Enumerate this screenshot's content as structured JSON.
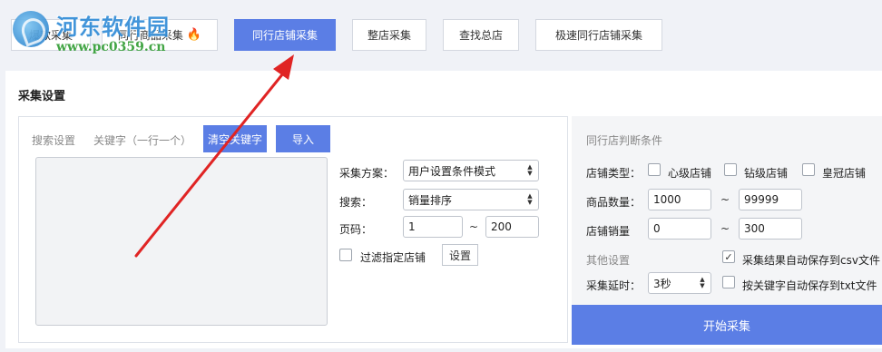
{
  "watermark": {
    "title": "河东软件园",
    "url": "www.pc0359.cn"
  },
  "tabs": [
    {
      "label": "爆款采集"
    },
    {
      "label": "同行商品采集"
    },
    {
      "label": "同行店铺采集"
    },
    {
      "label": "整店采集"
    },
    {
      "label": "查找总店"
    },
    {
      "label": "极速同行店铺采集"
    }
  ],
  "section_title": "采集设置",
  "left": {
    "sub_tab_search": "搜索设置",
    "sub_tab_keywords": "关键字（一行一个）",
    "clear_btn": "清空关键字",
    "import_btn": "导入",
    "keywords_value": "",
    "plan_label": "采集方案：",
    "plan_value": "用户设置条件模式",
    "search_label": "搜索：",
    "search_value": "销量排序",
    "page_label": "页码：",
    "page_from": "1",
    "page_to": "200",
    "tilde": "~",
    "filter_label": "过滤指定店铺",
    "filter_checked": false,
    "settings_btn": "设置"
  },
  "right": {
    "title": "同行店判断条件",
    "shop_type_label": "店铺类型：",
    "shop_types": [
      {
        "label": "心级店铺",
        "checked": false
      },
      {
        "label": "钻级店铺",
        "checked": false
      },
      {
        "label": "皇冠店铺",
        "checked": false
      }
    ],
    "product_count_label": "商品数量：",
    "product_count_from": "1000",
    "product_count_to": "99999",
    "shop_sales_label": "店铺销量",
    "shop_sales_from": "0",
    "shop_sales_to": "300",
    "tilde": "~",
    "other_label": "其他设置",
    "auto_save_csv_label": "采集结果自动保存到csv文件",
    "auto_save_csv_checked": true,
    "delay_label": "采集延时：",
    "delay_value": "3秒",
    "save_kw_txt_label": "按关键字自动保存到txt文件",
    "save_kw_txt_checked": false
  },
  "start_btn": "开始采集",
  "colors": {
    "accent": "#5b7ee5",
    "annotation_arrow": "#e02424",
    "flame": "#e8452c"
  },
  "icons": {
    "flame": "flame-icon",
    "spinner": "spinner-arrows-icon",
    "check": "check-icon"
  }
}
